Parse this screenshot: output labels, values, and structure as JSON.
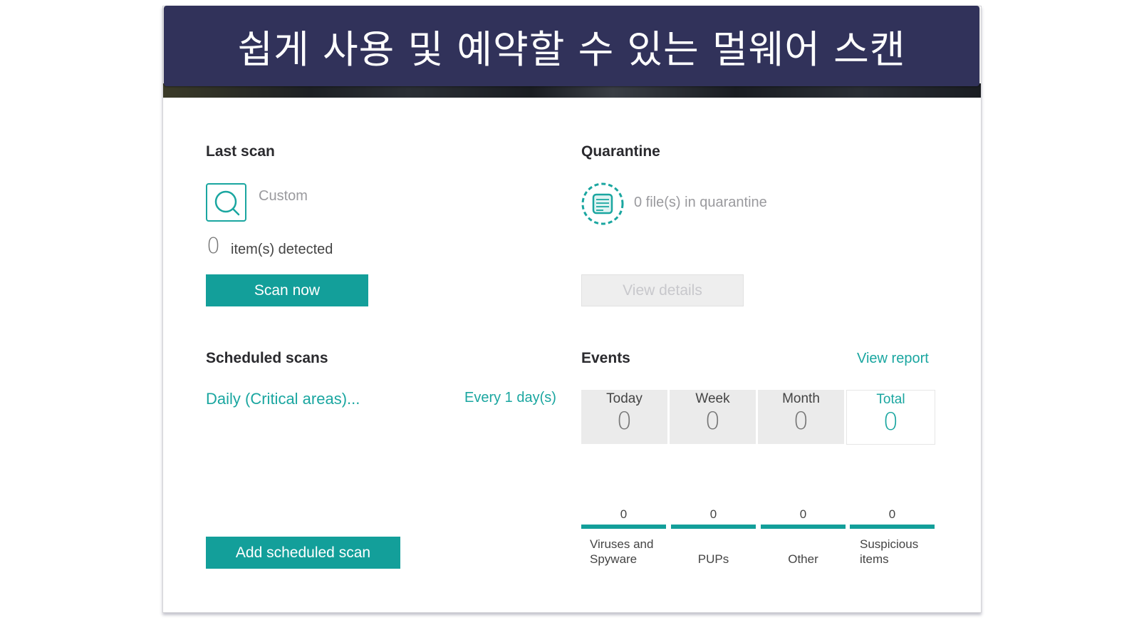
{
  "banner": {
    "title": "쉽게 사용 및 예약할 수 있는 멀웨어 스캔"
  },
  "last_scan": {
    "heading": "Last scan",
    "scan_type": "Custom",
    "detected_count": "0",
    "detected_label": "item(s) detected",
    "scan_now_label": "Scan now",
    "icon": "search-icon"
  },
  "quarantine": {
    "heading": "Quarantine",
    "status": "0 file(s) in quarantine",
    "view_details_label": "View details",
    "icon": "document-icon"
  },
  "scheduled": {
    "heading": "Scheduled scans",
    "items": [
      {
        "name": "Daily (Critical areas)...",
        "frequency": "Every 1 day(s)"
      }
    ],
    "add_label": "Add scheduled scan"
  },
  "events": {
    "heading": "Events",
    "view_report_label": "View report",
    "periods": [
      {
        "label": "Today",
        "value": "0"
      },
      {
        "label": "Week",
        "value": "0"
      },
      {
        "label": "Month",
        "value": "0"
      },
      {
        "label": "Total",
        "value": "0"
      }
    ],
    "categories": [
      {
        "value": "0",
        "label": "Viruses and Spyware"
      },
      {
        "value": "0",
        "label": "PUPs"
      },
      {
        "value": "0",
        "label": "Other"
      },
      {
        "value": "0",
        "label": "Suspicious items"
      }
    ]
  },
  "colors": {
    "accent": "#139f9a",
    "banner": "#31325a"
  }
}
